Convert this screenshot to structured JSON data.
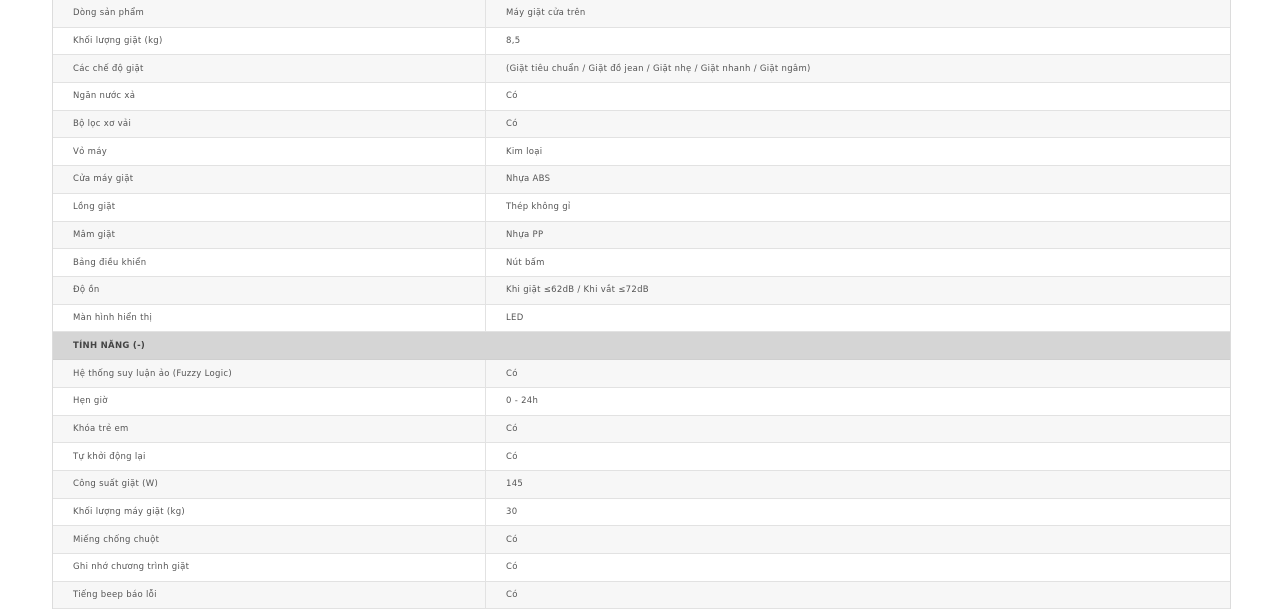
{
  "specs_group_1": [
    {
      "label": "Dòng sản phẩm",
      "value": "Máy giặt cửa trên"
    },
    {
      "label": "Khối lượng giặt (kg)",
      "value": "8,5"
    },
    {
      "label": "Các chế độ giặt",
      "value": "(Giặt tiêu chuẩn / Giặt đồ jean / Giặt nhẹ / Giặt nhanh / Giặt ngâm)"
    },
    {
      "label": "Ngăn nước xả",
      "value": "Có"
    },
    {
      "label": "Bộ lọc xơ vải",
      "value": "Có"
    },
    {
      "label": "Vỏ máy",
      "value": "Kim loại"
    },
    {
      "label": "Cửa máy giặt",
      "value": "Nhựa ABS"
    },
    {
      "label": "Lồng giặt",
      "value": "Thép không gỉ"
    },
    {
      "label": "Mâm giặt",
      "value": "Nhựa PP"
    },
    {
      "label": "Bảng điều khiển",
      "value": "Nút bấm"
    },
    {
      "label": "Độ ồn",
      "value": "Khi giặt ≤62dB / Khi vắt ≤72dB"
    },
    {
      "label": "Màn hình hiển thị",
      "value": "LED"
    }
  ],
  "section_header": "TÍNH NĂNG (-)",
  "specs_group_2": [
    {
      "label": "Hệ thống suy luận ảo (Fuzzy Logic)",
      "value": "Có"
    },
    {
      "label": "Hẹn giờ",
      "value": "0 - 24h"
    },
    {
      "label": "Khóa trẻ em",
      "value": "Có"
    },
    {
      "label": "Tự khởi động lại",
      "value": "Có"
    },
    {
      "label": "Công suất giặt (W)",
      "value": "145"
    },
    {
      "label": "Khối lượng máy giặt (kg)",
      "value": "30"
    },
    {
      "label": "Miếng chống chuột",
      "value": "Có"
    },
    {
      "label": "Ghi nhớ chương trình giặt",
      "value": "Có"
    },
    {
      "label": "Tiếng beep báo lỗi",
      "value": "Có"
    }
  ]
}
